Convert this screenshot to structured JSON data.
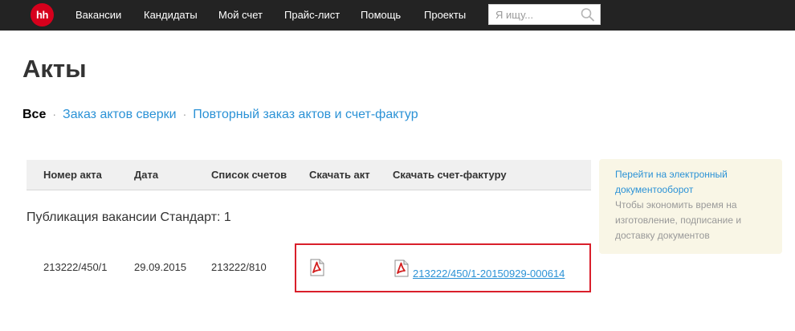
{
  "header": {
    "logo_text": "hh",
    "nav": [
      {
        "label": "Вакансии"
      },
      {
        "label": "Кандидаты"
      },
      {
        "label": "Мой счет"
      },
      {
        "label": "Прайс-лист"
      },
      {
        "label": "Помощь"
      },
      {
        "label": "Проекты"
      }
    ],
    "search_placeholder": "Я ищу...",
    "search_icon": "search-icon"
  },
  "page": {
    "title": "Акты"
  },
  "tabs": [
    {
      "label": "Все"
    },
    {
      "label": "Заказ актов сверки"
    },
    {
      "label": "Повторный заказ актов и счет-фактур"
    }
  ],
  "tab_separator": "·",
  "table": {
    "columns": [
      "Номер акта",
      "Дата",
      "Список счетов",
      "Скачать акт",
      "Скачать счет-фактуру"
    ],
    "group_title": "Публикация вакансии Стандарт: 1",
    "rows": [
      {
        "number": "213222/450/1",
        "date": "29.09.2015",
        "invoices": "213222/810",
        "act_icon": "pdf-icon",
        "invoice_icon": "pdf-icon",
        "invoice_link": "213222/450/1-20150929-000614"
      }
    ]
  },
  "side_panel": {
    "link": "Перейти на электронный документооборот",
    "text": "Чтобы экономить время на изготовление, подписание и доставку документов"
  },
  "colors": {
    "topbar": "#232323",
    "logo": "#d6001c",
    "link": "#2b92d6",
    "highlight": "#d91f2b",
    "panel": "#f9f6e6"
  }
}
